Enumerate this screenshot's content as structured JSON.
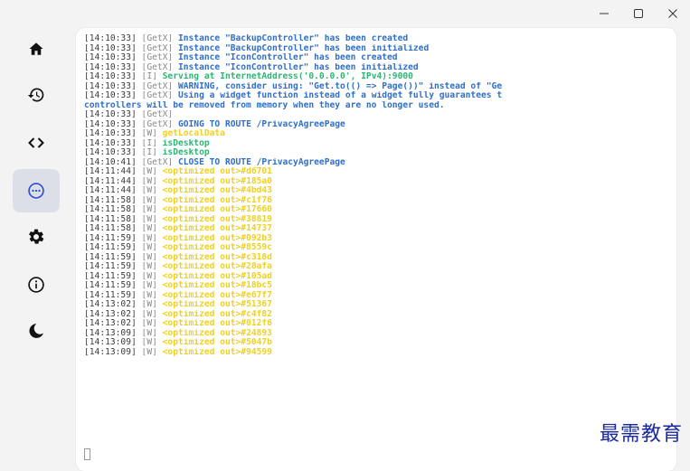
{
  "window": {
    "controls": {
      "minimize": "—",
      "maximize": "▢",
      "close": "✕"
    }
  },
  "sidebar": {
    "items": [
      {
        "name": "home",
        "icon": "home-icon",
        "active": false
      },
      {
        "name": "history",
        "icon": "history-icon",
        "active": false
      },
      {
        "name": "code",
        "icon": "code-icon",
        "active": false
      },
      {
        "name": "more",
        "icon": "more-horizontal-icon",
        "active": true
      },
      {
        "name": "settings",
        "icon": "gear-icon",
        "active": false
      },
      {
        "name": "info",
        "icon": "info-icon",
        "active": false
      },
      {
        "name": "theme",
        "icon": "moon-icon",
        "active": false
      }
    ]
  },
  "colors": {
    "getx": "#2f6fc8",
    "info": "#2bb673",
    "warn": "#f0d020",
    "active_nav": "#dcdfe8"
  },
  "log": [
    {
      "ts": "[14:10:33]",
      "tag": "[GetX]",
      "type": "getx",
      "msg": "Instance \"BackupController\" has been created"
    },
    {
      "ts": "[14:10:33]",
      "tag": "[GetX]",
      "type": "getx",
      "msg": "Instance \"BackupController\" has been initialized"
    },
    {
      "ts": "[14:10:33]",
      "tag": "[GetX]",
      "type": "getx",
      "msg": "Instance \"IconController\" has been created"
    },
    {
      "ts": "[14:10:33]",
      "tag": "[GetX]",
      "type": "getx",
      "msg": "Instance \"IconController\" has been initialized"
    },
    {
      "ts": "[14:10:33]",
      "tag": "[I]",
      "type": "info",
      "msg": "Serving at InternetAddress('0.0.0.0', IPv4):9000"
    },
    {
      "ts": "[14:10:33]",
      "tag": "[GetX]",
      "type": "getx",
      "msg": "WARNING, consider using: \"Get.to(() => Page())\" instead of \"Ge"
    },
    {
      "ts": "[14:10:33]",
      "tag": "[GetX]",
      "type": "getx",
      "msg": "Using a widget function instead of a widget fully guarantees t"
    },
    {
      "ts": "",
      "tag": "",
      "type": "getx",
      "msg": "controllers will be removed from memory when they are no longer used."
    },
    {
      "ts": "[14:10:33]",
      "tag": "[GetX]",
      "type": "getx",
      "msg": ""
    },
    {
      "ts": "[14:10:33]",
      "tag": "[GetX]",
      "type": "getx",
      "msg": "GOING TO ROUTE /PrivacyAgreePage"
    },
    {
      "ts": "[14:10:33]",
      "tag": "[W]",
      "type": "warn",
      "msg": "getLocalData"
    },
    {
      "ts": "[14:10:33]",
      "tag": "[I]",
      "type": "info",
      "msg": "isDesktop"
    },
    {
      "ts": "[14:10:33]",
      "tag": "[I]",
      "type": "info",
      "msg": "isDesktop"
    },
    {
      "ts": "[14:10:41]",
      "tag": "[GetX]",
      "type": "getx",
      "msg": "CLOSE TO ROUTE /PrivacyAgreePage"
    },
    {
      "ts": "[14:11:44]",
      "tag": "[W]",
      "type": "warn",
      "msg": "<optimized out>#d6701"
    },
    {
      "ts": "[14:11:44]",
      "tag": "[W]",
      "type": "warn",
      "msg": "<optimized out>#185a0"
    },
    {
      "ts": "[14:11:44]",
      "tag": "[W]",
      "type": "warn",
      "msg": "<optimized out>#4bd43"
    },
    {
      "ts": "[14:11:58]",
      "tag": "[W]",
      "type": "warn",
      "msg": "<optimized out>#c1f76"
    },
    {
      "ts": "[14:11:58]",
      "tag": "[W]",
      "type": "warn",
      "msg": "<optimized out>#17660"
    },
    {
      "ts": "[14:11:58]",
      "tag": "[W]",
      "type": "warn",
      "msg": "<optimized out>#38819"
    },
    {
      "ts": "[14:11:58]",
      "tag": "[W]",
      "type": "warn",
      "msg": "<optimized out>#14737"
    },
    {
      "ts": "[14:11:59]",
      "tag": "[W]",
      "type": "warn",
      "msg": "<optimized out>#092b3"
    },
    {
      "ts": "[14:11:59]",
      "tag": "[W]",
      "type": "warn",
      "msg": "<optimized out>#8559c"
    },
    {
      "ts": "[14:11:59]",
      "tag": "[W]",
      "type": "warn",
      "msg": "<optimized out>#c318d"
    },
    {
      "ts": "[14:11:59]",
      "tag": "[W]",
      "type": "warn",
      "msg": "<optimized out>#28afa"
    },
    {
      "ts": "[14:11:59]",
      "tag": "[W]",
      "type": "warn",
      "msg": "<optimized out>#105ad"
    },
    {
      "ts": "[14:11:59]",
      "tag": "[W]",
      "type": "warn",
      "msg": "<optimized out>#18bc5"
    },
    {
      "ts": "[14:11:59]",
      "tag": "[W]",
      "type": "warn",
      "msg": "<optimized out>#e67f7"
    },
    {
      "ts": "[14:13:02]",
      "tag": "[W]",
      "type": "warn",
      "msg": "<optimized out>#51367"
    },
    {
      "ts": "[14:13:02]",
      "tag": "[W]",
      "type": "warn",
      "msg": "<optimized out>#c4f82"
    },
    {
      "ts": "[14:13:02]",
      "tag": "[W]",
      "type": "warn",
      "msg": "<optimized out>#012f6"
    },
    {
      "ts": "[14:13:09]",
      "tag": "[W]",
      "type": "warn",
      "msg": "<optimized out>#24893"
    },
    {
      "ts": "[14:13:09]",
      "tag": "[W]",
      "type": "warn",
      "msg": "<optimized out>#5047b"
    },
    {
      "ts": "[14:13:09]",
      "tag": "[W]",
      "type": "warn",
      "msg": "<optimized out>#94599"
    }
  ],
  "watermark": "最需教育"
}
